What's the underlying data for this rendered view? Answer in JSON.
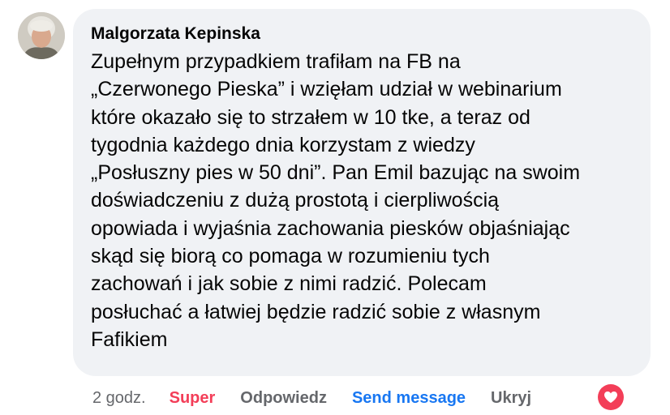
{
  "comment": {
    "author": "Malgorzata Kepinska",
    "text_lines": [
      "Zupełnym przypadkiem trafiłam na FB na",
      "„Czerwonego Pieska” i wzięłam udział w webinarium",
      "które okazało się to strzałem w 10 tke, a teraz od",
      "tygodnia każdego dnia korzystam z wiedzy",
      "„Posłuszny pies w 50 dni”. Pan Emil bazując na swoim",
      "doświadczeniu z dużą prostotą i cierpliwością",
      "opowiada i wyjaśnia zachowania piesków objaśniając",
      "skąd się biorą co pomaga w rozumieniu tych",
      "zachowań i jak sobie z nimi radzić. Polecam",
      "posłuchać a łatwiej będzie radzić sobie z własnym",
      "Fafikiem"
    ]
  },
  "actions": {
    "time": "2 godz.",
    "reaction_label": "Super",
    "reply_label": "Odpowiedz",
    "send_label": "Send message",
    "hide_label": "Ukryj"
  },
  "reaction_badge": {
    "icon": "heart-icon",
    "color": "#f33e58"
  },
  "colors": {
    "bubble_bg": "#f0f2f5",
    "text": "#050505",
    "muted": "#65676b",
    "love_red": "#f33e58",
    "link_blue": "#1877f2"
  }
}
